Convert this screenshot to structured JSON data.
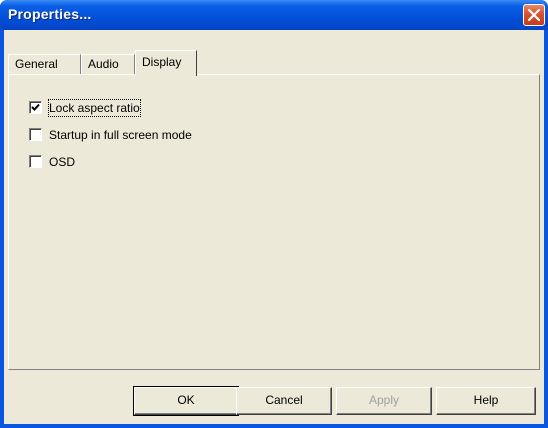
{
  "window": {
    "title": "Properties...",
    "close_icon": "close-icon"
  },
  "tabs": [
    {
      "label": "General",
      "selected": false
    },
    {
      "label": "Audio",
      "selected": false
    },
    {
      "label": "Display",
      "selected": true
    }
  ],
  "display_options": [
    {
      "label": "Lock aspect ratio",
      "checked": true
    },
    {
      "label": "Startup in full screen mode",
      "checked": false
    },
    {
      "label": "OSD",
      "checked": false
    }
  ],
  "buttons": {
    "ok": "OK",
    "cancel": "Cancel",
    "apply": "Apply",
    "help": "Help"
  },
  "colors": {
    "titlebar": "#0a5ee6",
    "close_button": "#d9502e",
    "dialog_face": "#ece9d8"
  }
}
